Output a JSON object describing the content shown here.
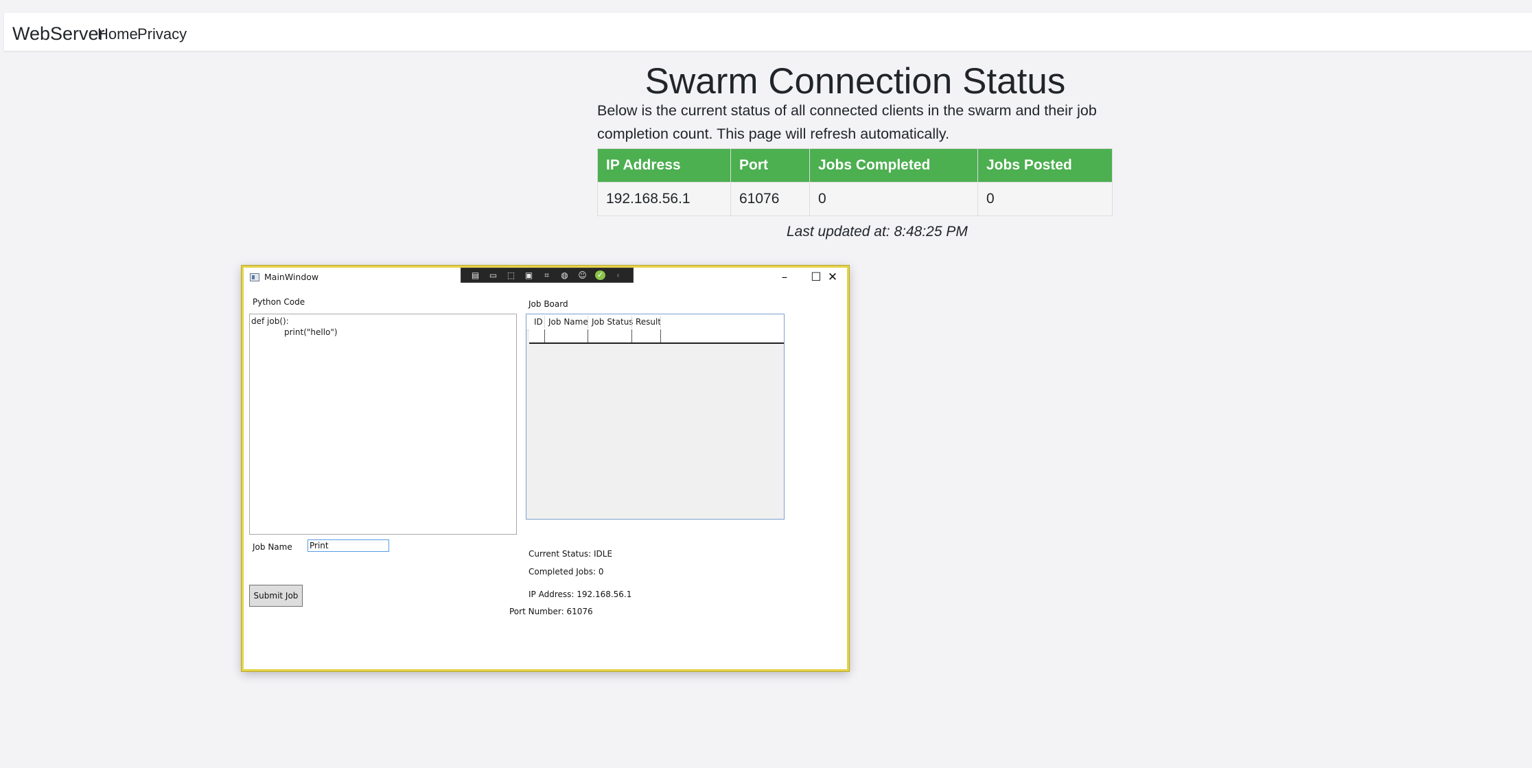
{
  "nav": {
    "brand": "WebServer",
    "links": [
      "Home",
      "Privacy"
    ]
  },
  "page": {
    "title": "Swarm Connection Status",
    "intro": "Below is the current status of all connected clients in the swarm and their job completion count. This page will refresh automatically.",
    "table": {
      "headers": [
        "IP Address",
        "Port",
        "Jobs Completed",
        "Jobs Posted"
      ],
      "rows": [
        [
          "192.168.56.1",
          "61076",
          "0",
          "0"
        ]
      ]
    },
    "last_updated": "Last updated at: 8:48:25 PM",
    "colors": {
      "table_header": "#4caf50",
      "background": "#f3f3f6"
    }
  },
  "window": {
    "title": "MainWindow",
    "controls": {
      "minimize": "–",
      "maximize": "☐",
      "close": "✕"
    },
    "debug_toolbar_icons": [
      "live-visual-tree-icon",
      "record-icon",
      "select-element-icon",
      "display-layout-adorners-icon",
      "track-focus-icon",
      "hot-reload-icon",
      "accessibility-icon",
      "check-icon",
      "collapse-icon"
    ],
    "python_code_label": "Python Code",
    "code_lines": [
      "def job():",
      "print(\"hello\")"
    ],
    "job_board_label": "Job Board",
    "grid_columns": [
      "ID",
      "Job Name",
      "Job Status",
      "Result"
    ],
    "job_name_label": "Job Name",
    "job_name_value": "Print",
    "submit_label": "Submit Job",
    "current_status": "Current Status: IDLE",
    "completed_jobs": "Completed Jobs: 0",
    "ip_address": "IP Address: 192.168.56.1",
    "port_number": "Port Number: 61076"
  }
}
